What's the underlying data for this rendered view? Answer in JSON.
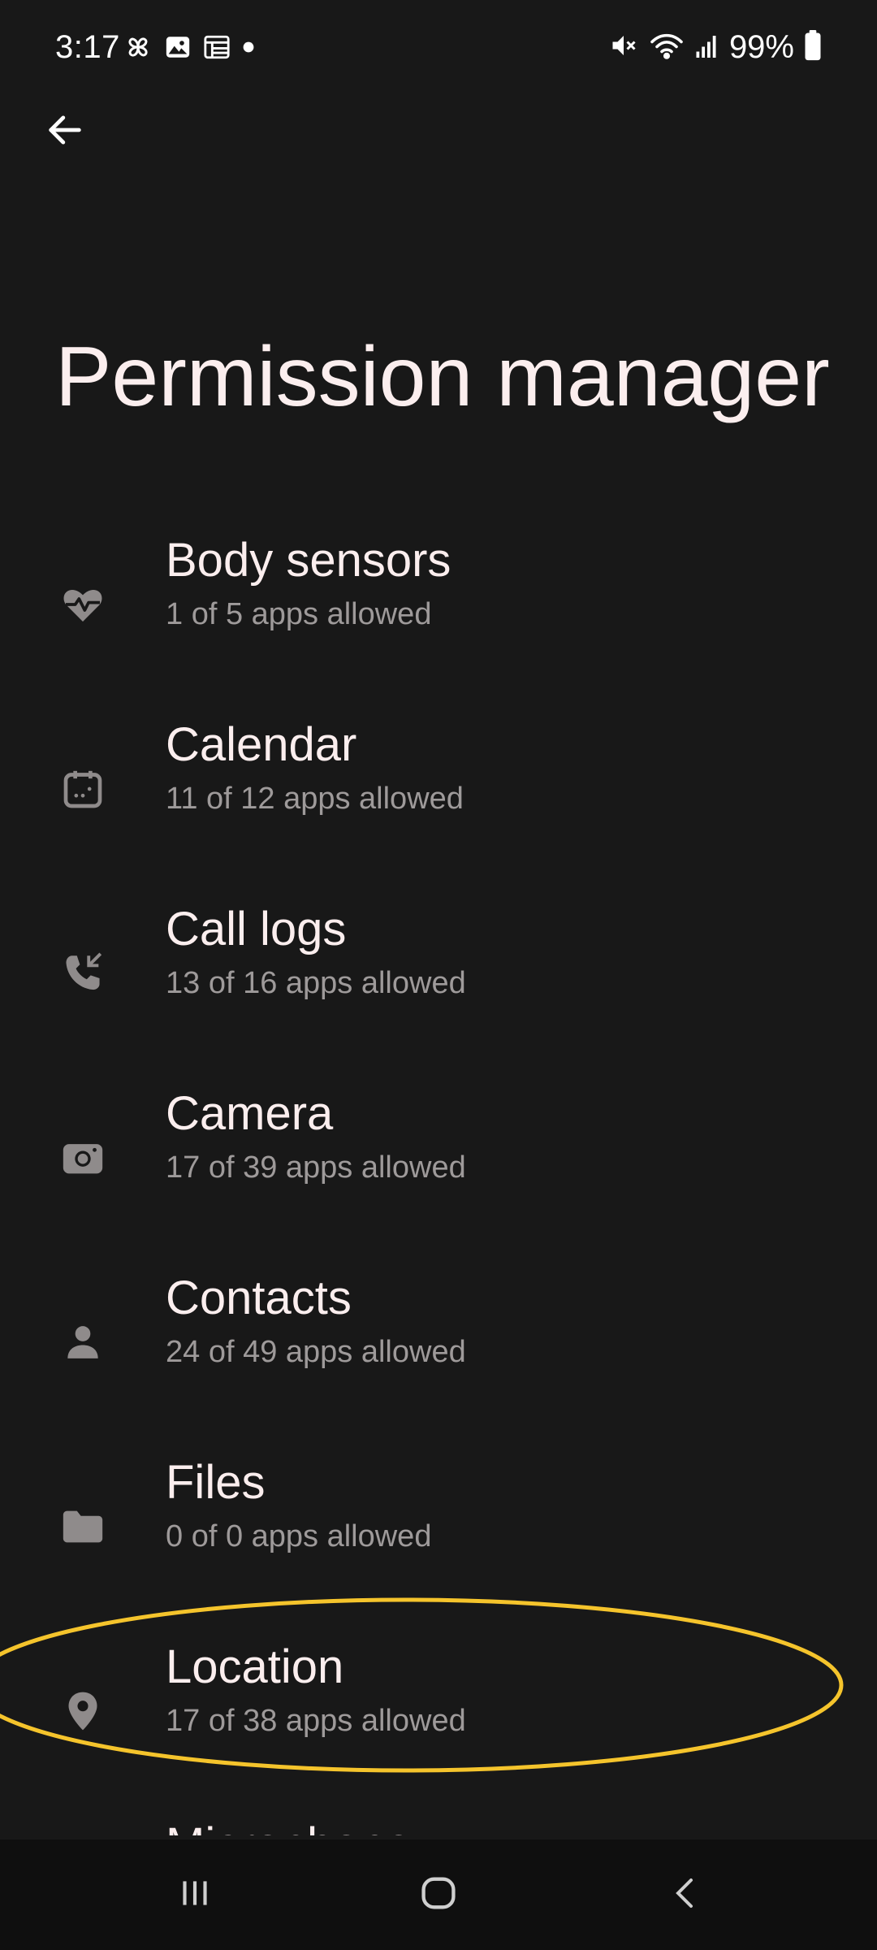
{
  "status_bar": {
    "time": "3:17",
    "battery": "99%",
    "left_icons": [
      "pinwheel-icon",
      "image-icon",
      "calendar-grid-icon",
      "dot-icon"
    ],
    "right_icons": [
      "mute-icon",
      "wifi-icon",
      "signal-icon",
      "battery-icon"
    ]
  },
  "header": {
    "back_icon": "back-arrow-icon",
    "title": "Permission manager"
  },
  "permissions": [
    {
      "label": "Body sensors",
      "summary": "1 of 5 apps allowed",
      "icon": "heart-pulse-icon"
    },
    {
      "label": "Calendar",
      "summary": "11 of 12 apps allowed",
      "icon": "calendar-icon"
    },
    {
      "label": "Call logs",
      "summary": "13 of 16 apps allowed",
      "icon": "phone-log-icon"
    },
    {
      "label": "Camera",
      "summary": "17 of 39 apps allowed",
      "icon": "camera-icon"
    },
    {
      "label": "Contacts",
      "summary": "24 of 49 apps allowed",
      "icon": "person-icon"
    },
    {
      "label": "Files",
      "summary": "0 of 0 apps allowed",
      "icon": "folder-icon"
    },
    {
      "label": "Location",
      "summary": "17 of 38 apps allowed",
      "icon": "location-pin-icon"
    },
    {
      "label": "Microphone",
      "summary": "",
      "icon": "microphone-icon"
    }
  ],
  "highlight": {
    "target": "Location",
    "color": "#f5c42c"
  },
  "nav_bar": {
    "icons": [
      "recents-icon",
      "home-icon",
      "back-icon"
    ]
  },
  "colors": {
    "background": "#181818",
    "title_text": "#fbeeee",
    "secondary_text": "#9e9a9a",
    "icon": "#8f8b8b"
  }
}
